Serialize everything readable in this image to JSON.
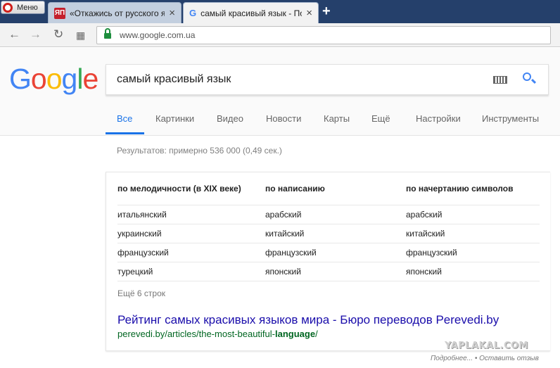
{
  "browser": {
    "menu_label": "Меню",
    "tabs": [
      {
        "title": "«Откажись от русского язы",
        "favicon": "ЯП"
      },
      {
        "title": "самый красивый язык - Пои",
        "favicon": "G"
      }
    ],
    "new_tab": "+",
    "close": "×",
    "address": "www.google.com.ua",
    "nav_icons": [
      "back-icon",
      "forward-icon",
      "reload-icon",
      "speed-dial-icon",
      "lock-icon"
    ]
  },
  "google": {
    "logo_letters": [
      {
        "ch": "G",
        "color": "#4285F4"
      },
      {
        "ch": "o",
        "color": "#EA4335"
      },
      {
        "ch": "o",
        "color": "#FBBC05"
      },
      {
        "ch": "g",
        "color": "#4285F4"
      },
      {
        "ch": "l",
        "color": "#34A853"
      },
      {
        "ch": "e",
        "color": "#EA4335"
      }
    ],
    "query": "самый красивый язык",
    "tabs": [
      "Все",
      "Картинки",
      "Видео",
      "Новости",
      "Карты",
      "Ещё",
      "Настройки",
      "Инструменты"
    ],
    "active_tab": "Все"
  },
  "results": {
    "count_text": "Результатов: примерно 536 000 (0,49 сек.)",
    "table": {
      "headers": [
        "по мелодичности (в XIX веке)",
        "по написанию",
        "по начертанию символов"
      ],
      "rows": [
        [
          "итальянский",
          "арабский",
          "арабский"
        ],
        [
          "украинский",
          "китайский",
          "китайский"
        ],
        [
          "французский",
          "французский",
          "французский"
        ],
        [
          "турецкий",
          "японский",
          "японский"
        ]
      ]
    },
    "more_rows": "Ещё 6 строк",
    "top_result": {
      "title": "Рейтинг самых красивых языков мира - Бюро переводов Perevedi.by",
      "url_prefix": "perevedi.by/articles/the-most-beautiful-",
      "url_bold": "language",
      "url_suffix": "/"
    }
  },
  "watermark": "YAPLAKAL.COM",
  "footer": "Подробнее... • Оставить отзыв"
}
